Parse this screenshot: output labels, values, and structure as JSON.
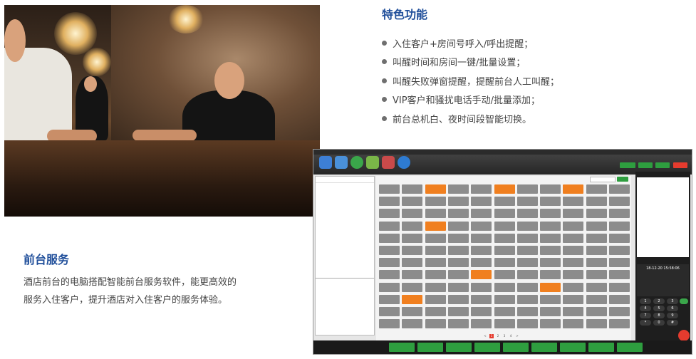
{
  "features": {
    "title": "特色功能",
    "items": [
      "入住客户+房间号呼入/呼出提醒；",
      "叫醒时间和房间一键/批量设置；",
      "叫醒失败弹窗提醒，提醒前台人工叫醒；",
      "VIP客户和骚扰电话手动/批量添加；",
      "前台总机白、夜时间段智能切换。"
    ]
  },
  "service": {
    "title": "前台服务",
    "line1": "酒店前台的电脑搭配智能前台服务软件，能更高效的",
    "line2": "服务入住客户，提升酒店对入住客户的服务体验。"
  },
  "app": {
    "clock": "18-12-20 15:58:06",
    "pager": [
      "<",
      "1",
      "2",
      "3",
      "4",
      ">"
    ],
    "keypad": [
      "1",
      "2",
      "3",
      "4",
      "5",
      "6",
      "7",
      "8",
      "9",
      "*",
      "0",
      "#"
    ]
  },
  "colors": {
    "heading": "#1f4e9a",
    "text": "#444444",
    "room_gray": "#8c8c8c",
    "room_orange": "#f07f1f",
    "button_green": "#2e9e3f"
  }
}
